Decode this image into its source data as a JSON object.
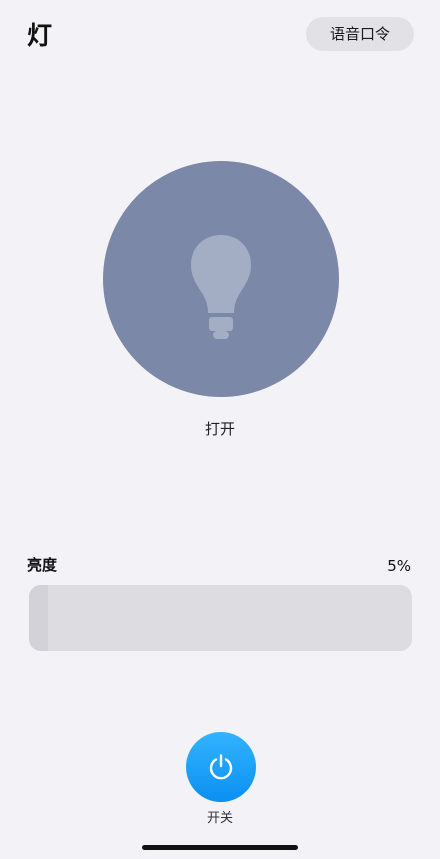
{
  "header": {
    "title": "灯",
    "voice_button_label": "语音口令"
  },
  "bulb": {
    "icon": "lightbulb-icon",
    "status_label": "打开",
    "circle_color": "#7c88a8"
  },
  "brightness": {
    "label": "亮度",
    "value_text": "5%",
    "value_percent": 5
  },
  "power": {
    "icon": "power-icon",
    "label": "开关",
    "accent_color": "#1ea0f7"
  }
}
